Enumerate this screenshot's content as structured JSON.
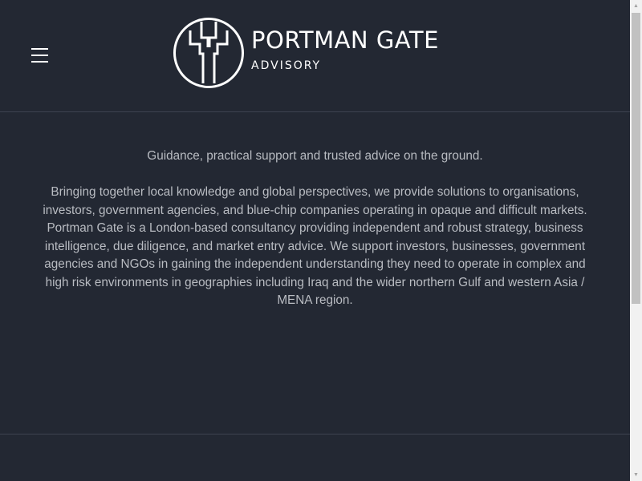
{
  "header": {
    "menu_icon": "hamburger-menu-icon",
    "logo": {
      "mark_icon": "portman-gate-logo-mark",
      "title": "PORTMAN GATE",
      "subtitle": "ADVISORY"
    }
  },
  "intro": {
    "tagline": "Guidance, practical support and trusted advice on the ground.",
    "body": "Bringing together local knowledge and global perspectives, we provide solutions to organisations, investors, government agencies, and blue-chip companies operating in opaque and difficult markets. Portman Gate is a London-based consultancy providing independent and robust strategy, business intelligence, due diligence, and market entry advice. We support investors, businesses, government agencies and NGOs in gaining the independent understanding they need to operate in complex and high risk environments in geographies including Iraq and the wider northern Gulf and western Asia / MENA region."
  },
  "colors": {
    "background": "#232833",
    "text": "#b9bcc2",
    "logo": "#ffffff",
    "divider": "#3d4350"
  },
  "scrollbar": {
    "up_icon": "scroll-up-arrow-icon",
    "down_icon": "scroll-down-arrow-icon"
  }
}
